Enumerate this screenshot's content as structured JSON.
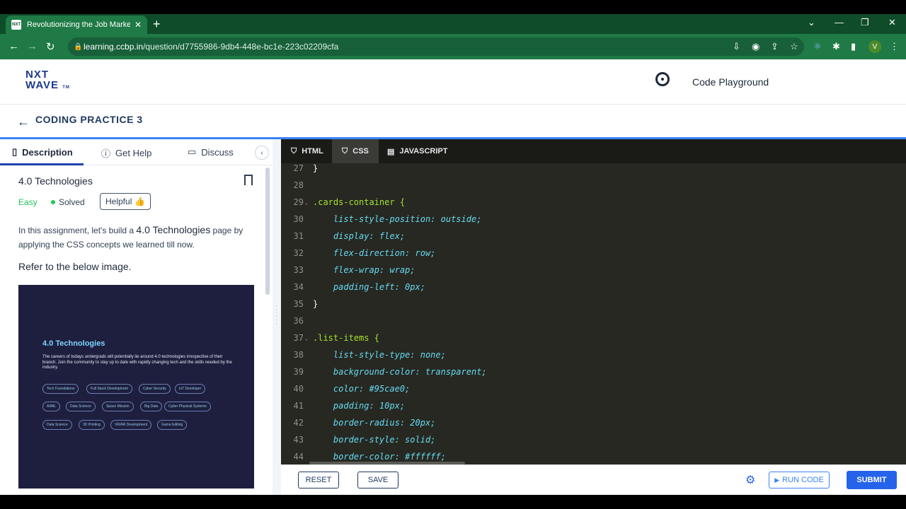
{
  "browser": {
    "tab_title": "Revolutionizing the Job Market |",
    "url_host": "learning.ccbp.in",
    "url_path": "/question/d7755986-9db4-448e-bc1e-223c02209cfa",
    "profile_initial": "V"
  },
  "header": {
    "logo_line1": "NXT",
    "logo_line2": "WAVE",
    "logo_tm": "TM",
    "playground": "Code Playground"
  },
  "subheader": {
    "title": "CODING PRACTICE 3"
  },
  "left": {
    "tabs": [
      {
        "label": "Description"
      },
      {
        "label": "Get Help"
      },
      {
        "label": "Discuss"
      }
    ],
    "question_title": "4.0 Technologies",
    "difficulty": "Easy",
    "status": "Solved",
    "helpful": "Helpful",
    "desc_pre": "In this assignment, let's build a ",
    "desc_hl": "4.0 Technologies",
    "desc_post": " page by applying the CSS concepts we learned till now.",
    "refer": "Refer to the below image.",
    "preview": {
      "title": "4.0 Technologies",
      "desc": "The careers of todays undergrads will potentially lie around 4.0 technologies irrespective of their branch. Join the community to stay up to date with rapidly changing tech and the skills needed by the industry.",
      "pills": [
        "Tech Foundations",
        "Full Stack Development",
        "Cyber Security",
        "IoT Developer",
        "AI/ML",
        "Data Science",
        "Space Mission",
        "Big Data",
        "Cyber Physical Systems",
        "Data Science",
        "3D Printing",
        "VR/AR Development",
        "Game Editing"
      ]
    }
  },
  "editor": {
    "tabs": [
      {
        "label": "HTML"
      },
      {
        "label": "CSS"
      },
      {
        "label": "JAVASCRIPT"
      }
    ],
    "lines": [
      {
        "n": "27",
        "t": "}"
      },
      {
        "n": "28",
        "t": ""
      },
      {
        "n": "29",
        "t": ".cards-container {"
      },
      {
        "n": "30",
        "t": "    list-style-position: outside;"
      },
      {
        "n": "31",
        "t": "    display: flex;"
      },
      {
        "n": "32",
        "t": "    flex-direction: row;"
      },
      {
        "n": "33",
        "t": "    flex-wrap: wrap;"
      },
      {
        "n": "34",
        "t": "    padding-left: 0px;"
      },
      {
        "n": "35",
        "t": "}"
      },
      {
        "n": "36",
        "t": ""
      },
      {
        "n": "37",
        "t": ".list-items {"
      },
      {
        "n": "38",
        "t": "    list-style-type: none;"
      },
      {
        "n": "39",
        "t": "    background-color: transparent;"
      },
      {
        "n": "40",
        "t": "    color: #95cae0;"
      },
      {
        "n": "41",
        "t": "    padding: 10px;"
      },
      {
        "n": "42",
        "t": "    border-radius: 20px;"
      },
      {
        "n": "43",
        "t": "    border-style: solid;"
      },
      {
        "n": "44",
        "t": "    border-color: #ffffff;"
      }
    ]
  },
  "bottom": {
    "reset": "RESET",
    "save": "SAVE",
    "run": "RUN CODE",
    "submit": "SUBMIT"
  }
}
